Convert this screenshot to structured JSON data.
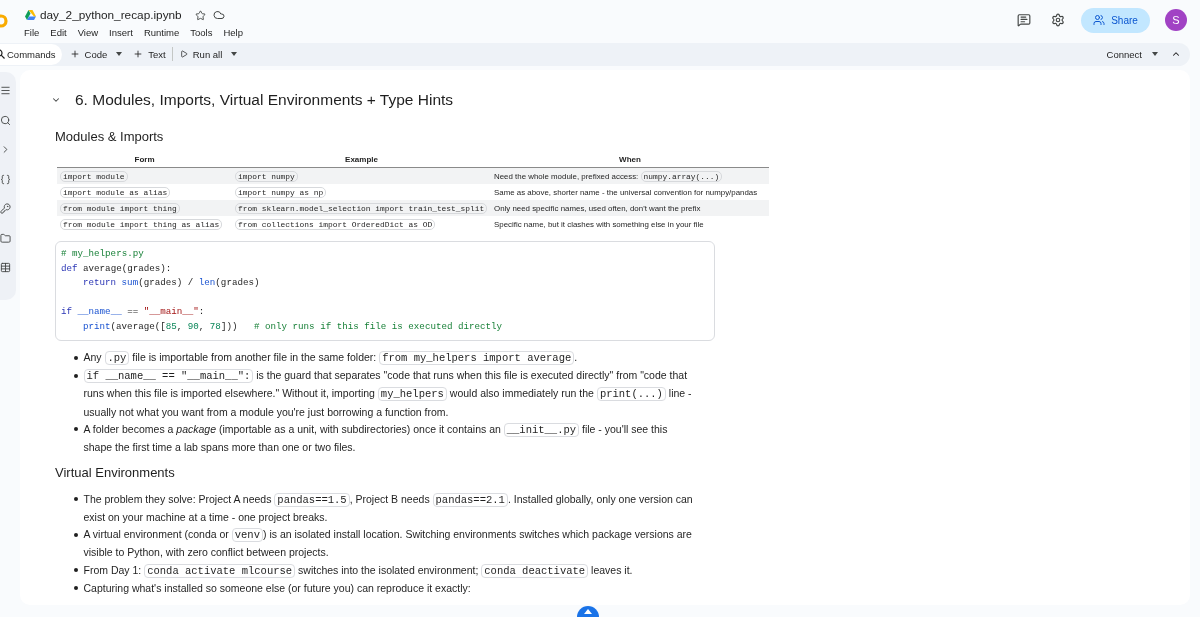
{
  "header": {
    "title": "day_2_python_recap.ipynb",
    "menu": [
      "File",
      "Edit",
      "View",
      "Insert",
      "Runtime",
      "Tools",
      "Help"
    ],
    "share": "Share",
    "avatar": "S"
  },
  "toolbar": {
    "commands": "Commands",
    "add_code": "Code",
    "add_text": "Text",
    "run_all": "Run all",
    "connect": "Connect"
  },
  "notebook": {
    "expanded": true,
    "heading": "6. Modules, Imports, Virtual Environments + Type Hints",
    "blocks": [
      {
        "kind": "subheading",
        "text": "Modules & Imports"
      },
      {
        "kind": "table",
        "columns": [
          "Form",
          "Example",
          "When"
        ],
        "rows": [
          {
            "cells": [
              [
                {
                  "kind": "code",
                  "text": "import module"
                }
              ],
              [
                {
                  "kind": "code",
                  "text": "import numpy"
                }
              ],
              [
                {
                  "kind": "text",
                  "text": "Need the whole module, prefixed access: "
                },
                {
                  "kind": "code",
                  "text": "numpy.array(...)"
                }
              ]
            ]
          },
          {
            "cells": [
              [
                {
                  "kind": "code",
                  "text": "import module as alias"
                }
              ],
              [
                {
                  "kind": "code",
                  "text": "import numpy as np"
                }
              ],
              [
                {
                  "kind": "text",
                  "text": "Same as above, shorter name - the universal convention for numpy/pandas"
                }
              ]
            ]
          },
          {
            "cells": [
              [
                {
                  "kind": "code",
                  "text": "from module import thing"
                }
              ],
              [
                {
                  "kind": "code",
                  "text": "from sklearn.model_selection import train_test_split"
                }
              ],
              [
                {
                  "kind": "text",
                  "text": "Only need specific names, used often, don't want the prefix"
                }
              ]
            ]
          },
          {
            "cells": [
              [
                {
                  "kind": "code",
                  "text": "from module import thing as alias"
                }
              ],
              [
                {
                  "kind": "code",
                  "text": "from collections import OrderedDict as OD"
                }
              ],
              [
                {
                  "kind": "text",
                  "text": "Specific name, but it clashes with something else in your file"
                }
              ]
            ]
          }
        ]
      },
      {
        "kind": "code",
        "lines": [
          {
            "kind": "code",
            "indented": false,
            "tokens": [
              {
                "kind": "comment",
                "text": "# my_helpers.py"
              }
            ]
          },
          {
            "kind": "code",
            "indented": false,
            "tokens": [
              {
                "kind": "keyword",
                "text": "def "
              },
              {
                "kind": "plain",
                "text": "average(grades):"
              }
            ]
          },
          {
            "kind": "code",
            "indented": true,
            "tokens": [
              {
                "kind": "keyword",
                "text": "return "
              },
              {
                "kind": "builtin",
                "text": "sum"
              },
              {
                "kind": "plain",
                "text": "(grades) / "
              },
              {
                "kind": "builtin",
                "text": "len"
              },
              {
                "kind": "plain",
                "text": "(grades)"
              }
            ]
          },
          {
            "kind": "blank"
          },
          {
            "kind": "code",
            "indented": false,
            "tokens": [
              {
                "kind": "keyword",
                "text": "if "
              },
              {
                "kind": "builtin",
                "text": "__name__"
              },
              {
                "kind": "plain",
                "text": " == "
              },
              {
                "kind": "string",
                "text": "\"__main__\""
              },
              {
                "kind": "plain",
                "text": ":"
              }
            ]
          },
          {
            "kind": "code",
            "indented": true,
            "tokens": [
              {
                "kind": "builtin",
                "text": "print"
              },
              {
                "kind": "plain",
                "text": "(average(["
              },
              {
                "kind": "number",
                "text": "85"
              },
              {
                "kind": "plain",
                "text": ", "
              },
              {
                "kind": "number",
                "text": "90"
              },
              {
                "kind": "plain",
                "text": ", "
              },
              {
                "kind": "number",
                "text": "78"
              },
              {
                "kind": "plain",
                "text": "]))   "
              },
              {
                "kind": "comment",
                "text": "# only runs if this file is executed directly"
              }
            ]
          }
        ]
      },
      {
        "kind": "bullets",
        "items": [
          {
            "parts": [
              {
                "kind": "text",
                "text": "Any "
              },
              {
                "kind": "code",
                "text": ".py"
              },
              {
                "kind": "text",
                "text": " file is importable from another file in the same folder: "
              },
              {
                "kind": "code",
                "text": "from my_helpers import average"
              },
              {
                "kind": "text",
                "text": "."
              }
            ]
          },
          {
            "parts": [
              {
                "kind": "code",
                "text": "if __name__ == \"__main__\":"
              },
              {
                "kind": "text",
                "text": " is the guard that separates \"code that runs when this file is executed directly\" from \"code that runs when this file is imported elsewhere.\" Without it, importing "
              },
              {
                "kind": "code",
                "text": "my_helpers"
              },
              {
                "kind": "text",
                "text": " would also immediately run the "
              },
              {
                "kind": "code",
                "text": "print(...)"
              },
              {
                "kind": "text",
                "text": " line - usually not what you want from a module you're just borrowing a function from."
              }
            ]
          },
          {
            "parts": [
              {
                "kind": "text",
                "text": "A folder becomes a *package* (importable as a unit, with subdirectories) once it contains an "
              },
              {
                "kind": "code",
                "text": "__init__.py"
              },
              {
                "kind": "text",
                "text": " file - you'll see this shape the first time a lab spans more than one or two files."
              }
            ]
          }
        ]
      },
      {
        "kind": "subheading",
        "text": "Virtual Environments"
      },
      {
        "kind": "bullets",
        "items": [
          {
            "parts": [
              {
                "kind": "text",
                "text": "The problem they solve: Project A needs "
              },
              {
                "kind": "code",
                "text": "pandas==1.5"
              },
              {
                "kind": "text",
                "text": ", Project B needs "
              },
              {
                "kind": "code",
                "text": "pandas==2.1"
              },
              {
                "kind": "text",
                "text": ". Installed globally, only one version can exist on your machine at a time - one project breaks."
              }
            ]
          },
          {
            "parts": [
              {
                "kind": "text",
                "text": "A virtual environment (conda or "
              },
              {
                "kind": "code",
                "text": "venv"
              },
              {
                "kind": "text",
                "text": ") is an isolated install location. Switching environments switches which package versions are visible to Python, with zero conflict between projects."
              }
            ]
          },
          {
            "parts": [
              {
                "kind": "text",
                "text": "From Day 1: "
              },
              {
                "kind": "code",
                "text": "conda activate mlcourse"
              },
              {
                "kind": "text",
                "text": " switches into the isolated environment; "
              },
              {
                "kind": "code",
                "text": "conda deactivate"
              },
              {
                "kind": "text",
                "text": " leaves it."
              }
            ]
          },
          {
            "parts": [
              {
                "kind": "text",
                "text": "Capturing what's installed so someone else (or future you) can reproduce it exactly:"
              }
            ]
          }
        ]
      }
    ]
  }
}
